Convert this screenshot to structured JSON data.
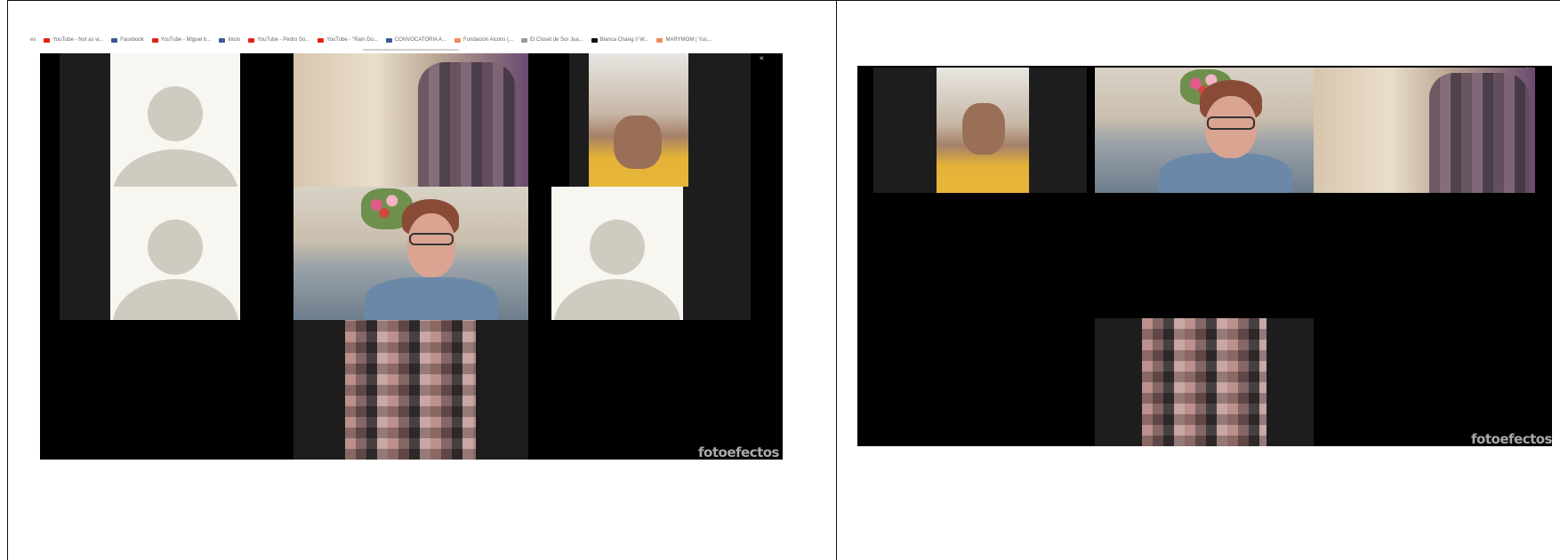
{
  "bookmarks": [
    {
      "label": "es",
      "icon": "none-icon"
    },
    {
      "label": "YouTube - Not as w...",
      "icon": "youtube-icon"
    },
    {
      "label": "Facebook",
      "icon": "facebook-icon"
    },
    {
      "label": "YouTube - Miguel b...",
      "icon": "youtube-icon"
    },
    {
      "label": "Inicio",
      "icon": "facebook-icon"
    },
    {
      "label": "YouTube - Pedro So...",
      "icon": "youtube-icon"
    },
    {
      "label": "YouTube - \"Rain Do...",
      "icon": "youtube-icon"
    },
    {
      "label": "CONVOCATORIA A...",
      "icon": "facebook-icon"
    },
    {
      "label": "Fundación Alcons (...",
      "icon": "site-icon"
    },
    {
      "label": "El Closet de Sor Jua...",
      "icon": "bookmark-icon"
    },
    {
      "label": "Bianca Chang // W...",
      "icon": "site-black-icon"
    },
    {
      "label": "MARYMOM | Yus...",
      "icon": "site-icon"
    }
  ],
  "window_controls": {
    "minimize": "–",
    "maximize": "▫",
    "close": "✕"
  },
  "watermark": "fotoefectos",
  "colors": {
    "youtube": "#e62117",
    "facebook": "#3b5998",
    "site": "#f28b5c",
    "site_black": "#111111",
    "zoom_background": "#000000",
    "tile_dark": "#1d1d1d",
    "avatar_card": "#f7f6f1",
    "avatar_silhouette": "#cfcbc0"
  }
}
